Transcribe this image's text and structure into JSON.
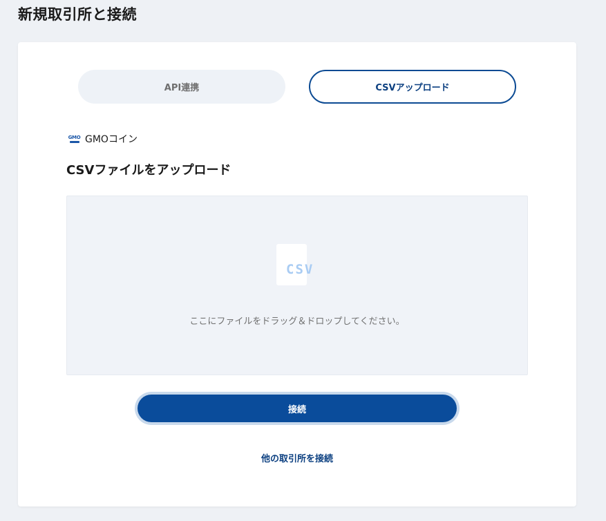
{
  "page": {
    "title": "新規取引所と接続"
  },
  "tabs": [
    {
      "label": "API連携",
      "active": false
    },
    {
      "label": "CSVアップロード",
      "active": true
    }
  ],
  "exchange": {
    "logo_icon": "gmo-coin-logo",
    "name": "GMOコイン"
  },
  "upload": {
    "title": "CSVファイルをアップロード",
    "file_icon_label": "CSV",
    "drop_hint": "ここにファイルをドラッグ＆ドロップしてください。"
  },
  "actions": {
    "connect_label": "接続",
    "other_exchange_label": "他の取引所を接続"
  },
  "colors": {
    "accent": "#0a4c9b",
    "background": "#eef1f5",
    "dropzone": "#f0f3f8",
    "inactive_tab": "#eef2f7"
  }
}
